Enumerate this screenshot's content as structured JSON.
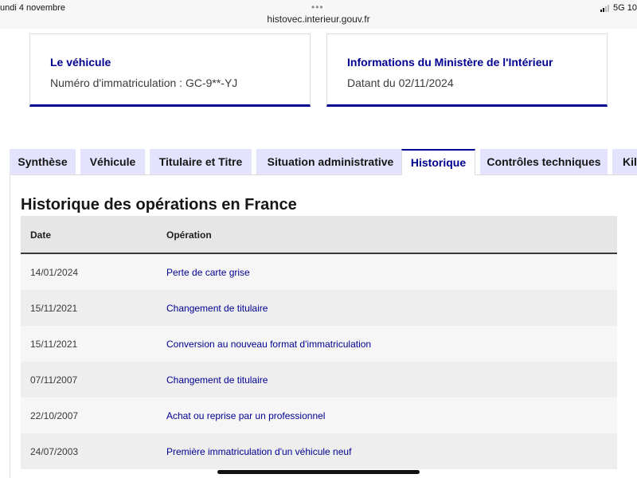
{
  "status_bar": {
    "date": "undi 4 novembre",
    "url": "histovec.interieur.gouv.fr",
    "network": "5G 10"
  },
  "cards": [
    {
      "title": "Le véhicule",
      "text": "Numéro d'immatriculation : GC-9**-YJ"
    },
    {
      "title": "Informations du Ministère de l'Intérieur",
      "text": "Datant du 02/11/2024"
    }
  ],
  "tabs": [
    {
      "label": "Synthèse",
      "active": false
    },
    {
      "label": "Véhicule",
      "active": false
    },
    {
      "label": "Titulaire et Titre",
      "active": false
    },
    {
      "label": "Situation administrative",
      "active": false
    },
    {
      "label": "Historique",
      "active": true
    },
    {
      "label": "Contrôles techniques",
      "active": false
    },
    {
      "label": "Kil",
      "active": false
    }
  ],
  "section": {
    "title": "Historique des opérations en France",
    "columns": {
      "date": "Date",
      "operation": "Opération"
    },
    "rows": [
      {
        "date": "14/01/2024",
        "operation": "Perte de carte grise"
      },
      {
        "date": "15/11/2021",
        "operation": "Changement de titulaire"
      },
      {
        "date": "15/11/2021",
        "operation": "Conversion au nouveau format d'immatriculation"
      },
      {
        "date": "07/11/2007",
        "operation": "Changement de titulaire"
      },
      {
        "date": "22/10/2007",
        "operation": "Achat ou reprise par un professionnel"
      },
      {
        "date": "24/07/2003",
        "operation": "Première immatriculation d'un véhicule neuf"
      }
    ]
  },
  "colors": {
    "accent": "#000091",
    "tab_bg": "#e3e3fd"
  }
}
